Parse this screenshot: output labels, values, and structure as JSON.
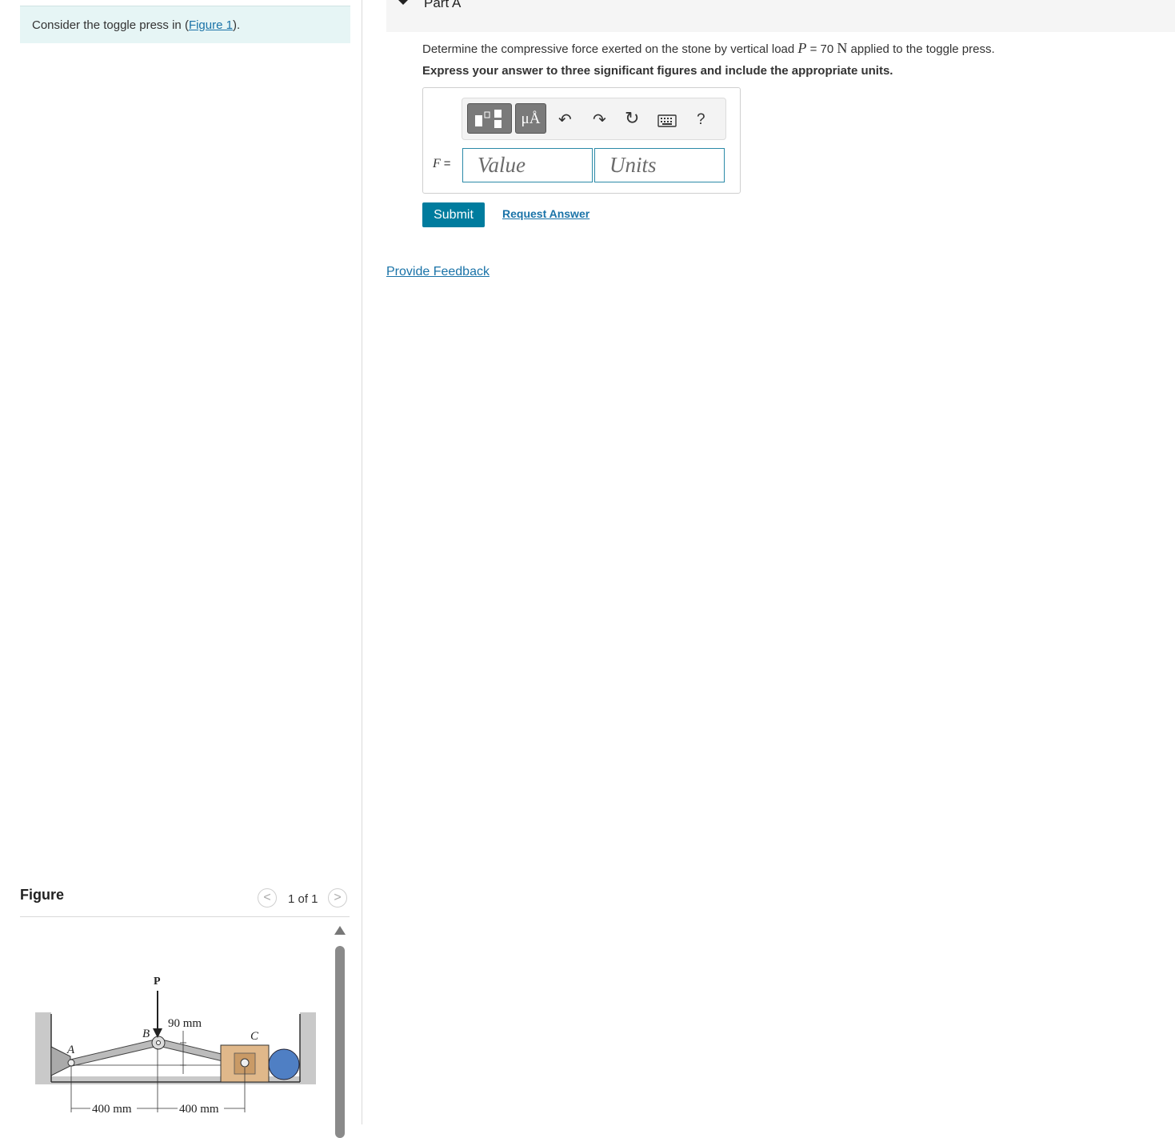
{
  "intro": {
    "prefix": "Consider the toggle press in (",
    "figure_link": "Figure 1",
    "suffix": ")."
  },
  "part": {
    "title": "Part A",
    "question_before": "Determine the compressive force exerted on the stone by vertical load ",
    "question_var": "P",
    "question_eq": " = 70 ",
    "question_unit": "N",
    "question_after": " applied to the toggle press.",
    "instruction": "Express your answer to three significant figures and include the appropriate units."
  },
  "toolbar": {
    "units_button": "μÅ",
    "undo_icon": "↶",
    "redo_icon": "↷",
    "reset_icon": "↻",
    "help_label": "?"
  },
  "answer": {
    "variable": "F",
    "equals": "=",
    "value_placeholder": "Value",
    "units_placeholder": "Units",
    "value": "",
    "units": ""
  },
  "actions": {
    "submit": "Submit",
    "request_answer": "Request Answer",
    "provide_feedback": "Provide Feedback"
  },
  "figure": {
    "heading": "Figure",
    "pager": "1 of 1",
    "prev": "<",
    "next": ">",
    "labels": {
      "p": "P",
      "b": "B",
      "a": "A",
      "c": "C",
      "dim_90": "90 mm",
      "dim_400_left": "400 mm",
      "dim_400_right": "400 mm"
    }
  }
}
